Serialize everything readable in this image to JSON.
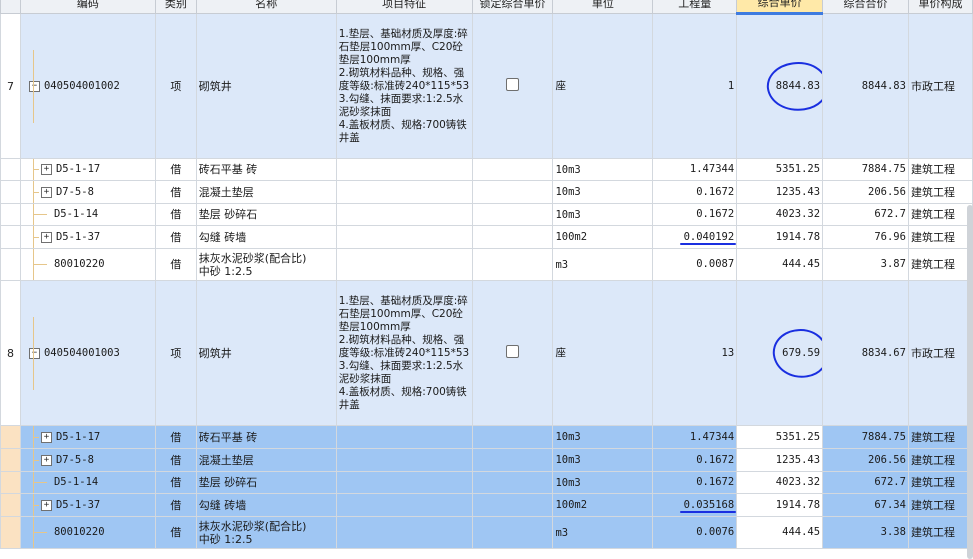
{
  "columns": [
    "编码",
    "类别",
    "名称",
    "项目特征",
    "锁定综合单价",
    "单位",
    "工程量",
    "综合单价",
    "综合合价",
    "单价构成"
  ],
  "rows": [
    {
      "kind": "main",
      "num": "7",
      "code": "040504001002",
      "type": "项",
      "name": "砌筑井",
      "features": [
        "1.垫层、基础材质及厚度:碎石垫层100mm厚、C20砼垫层100mm厚",
        "2.砌筑材料品种、规格、强度等级:标准砖240*115*53",
        "3.勾缝、抹面要求:1:2.5水泥砂浆抹面",
        "4.盖板材质、规格:700铸铁井盖"
      ],
      "unit": "座",
      "qty": "1",
      "price": "8844.83",
      "total": "8844.83",
      "comp": "市政工程"
    },
    {
      "kind": "sub",
      "code": "D5-1-17",
      "type": "借",
      "name": "砖石平基 砖",
      "unit": "10m3",
      "qty": "1.47344",
      "price": "5351.25",
      "total": "7884.75",
      "comp": "建筑工程",
      "toggle": "+"
    },
    {
      "kind": "sub",
      "code": "D7-5-8",
      "type": "借",
      "name": "混凝土垫层",
      "unit": "10m3",
      "qty": "0.1672",
      "price": "1235.43",
      "total": "206.56",
      "comp": "建筑工程",
      "toggle": "+"
    },
    {
      "kind": "sub",
      "code": "D5-1-14",
      "type": "借",
      "name": "垫层 砂碎石",
      "unit": "10m3",
      "qty": "0.1672",
      "price": "4023.32",
      "total": "672.7",
      "comp": "建筑工程"
    },
    {
      "kind": "sub",
      "code": "D5-1-37",
      "type": "借",
      "name": "勾缝 砖墙",
      "unit": "100m2",
      "qty": "0.040192",
      "price": "1914.78",
      "total": "76.96",
      "comp": "建筑工程",
      "toggle": "+"
    },
    {
      "kind": "sub",
      "code": "80010220",
      "type": "借",
      "name": "抹灰水泥砂浆(配合比)",
      "name2": "中砂 1:2.5",
      "unit": "m3",
      "qty": "0.0087",
      "price": "444.45",
      "total": "3.87",
      "comp": "建筑工程"
    },
    {
      "kind": "main",
      "num": "8",
      "code": "040504001003",
      "type": "项",
      "name": "砌筑井",
      "features": [
        "1.垫层、基础材质及厚度:碎石垫层100mm厚、C20砼垫层100mm厚",
        "2.砌筑材料品种、规格、强度等级:标准砖240*115*53",
        "3.勾缝、抹面要求:1:2.5水泥砂浆抹面",
        "4.盖板材质、规格:700铸铁井盖"
      ],
      "unit": "座",
      "qty": "13",
      "price": "679.59",
      "total": "8834.67",
      "comp": "市政工程"
    },
    {
      "kind": "sel",
      "code": "D5-1-17",
      "type": "借",
      "name": "砖石平基 砖",
      "unit": "10m3",
      "qty": "1.47344",
      "price": "5351.25",
      "total": "7884.75",
      "comp": "建筑工程",
      "toggle": "+"
    },
    {
      "kind": "sel",
      "code": "D7-5-8",
      "type": "借",
      "name": "混凝土垫层",
      "unit": "10m3",
      "qty": "0.1672",
      "price": "1235.43",
      "total": "206.56",
      "comp": "建筑工程",
      "toggle": "+"
    },
    {
      "kind": "sel",
      "code": "D5-1-14",
      "type": "借",
      "name": "垫层 砂碎石",
      "unit": "10m3",
      "qty": "0.1672",
      "price": "4023.32",
      "total": "672.7",
      "comp": "建筑工程"
    },
    {
      "kind": "sel",
      "code": "D5-1-37",
      "type": "借",
      "name": "勾缝 砖墙",
      "unit": "100m2",
      "qty": "0.035168",
      "price": "1914.78",
      "total": "67.34",
      "comp": "建筑工程",
      "toggle": "+"
    },
    {
      "kind": "sel",
      "code": "80010220",
      "type": "借",
      "name": "抹灰水泥砂浆(配合比)",
      "name2": "中砂 1:2.5",
      "unit": "m3",
      "qty": "0.0076",
      "price": "444.45",
      "total": "3.38",
      "comp": "建筑工程"
    }
  ]
}
